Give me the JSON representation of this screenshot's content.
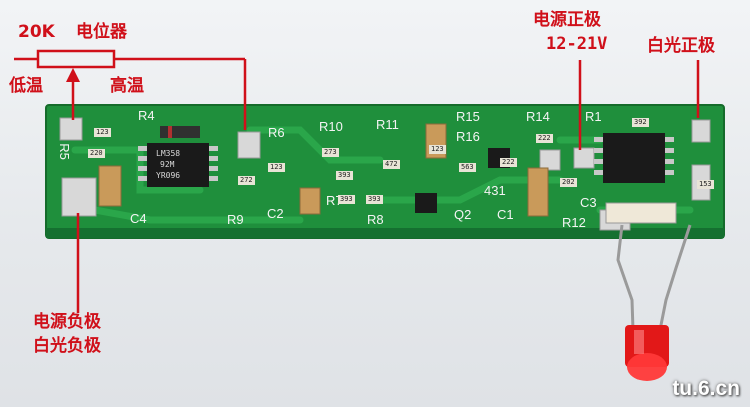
{
  "annotations": {
    "pot_resistance": "20K",
    "pot_name": "电位器",
    "low_temp": "低温",
    "high_temp": "高温",
    "pos_power_line1": "电源正极",
    "pos_power_line2": "12-21V",
    "led_pos": "白光正极",
    "neg_line1": "电源负极",
    "neg_line2": "白光负极"
  },
  "silkscreen": {
    "r4": "R4",
    "r5": "R5",
    "r6": "R6",
    "r7": "R7",
    "r8": "R8",
    "r9": "R9",
    "r10": "R10",
    "r11": "R11",
    "r12": "R12",
    "r14": "R14",
    "r15": "R15",
    "r16": "R16",
    "r1": "R1",
    "c1": "C1",
    "c2": "C2",
    "c3": "C3",
    "c4": "C4",
    "q2": "Q2",
    "u431": "431"
  },
  "chips": {
    "lm358_line1": "LM358",
    "lm358_line2": "92M",
    "lm358_line3": "YR096"
  },
  "resistor_codes": [
    "123",
    "220",
    "272",
    "273",
    "393",
    "123",
    "472",
    "222",
    "393",
    "123",
    "563",
    "222",
    "392",
    "202",
    "393",
    "153"
  ],
  "watermark": "tu.6.cn",
  "colors": {
    "annotation": "#d0101a",
    "pcb": "#1f8f3c",
    "pad": "#d8d8d8"
  }
}
